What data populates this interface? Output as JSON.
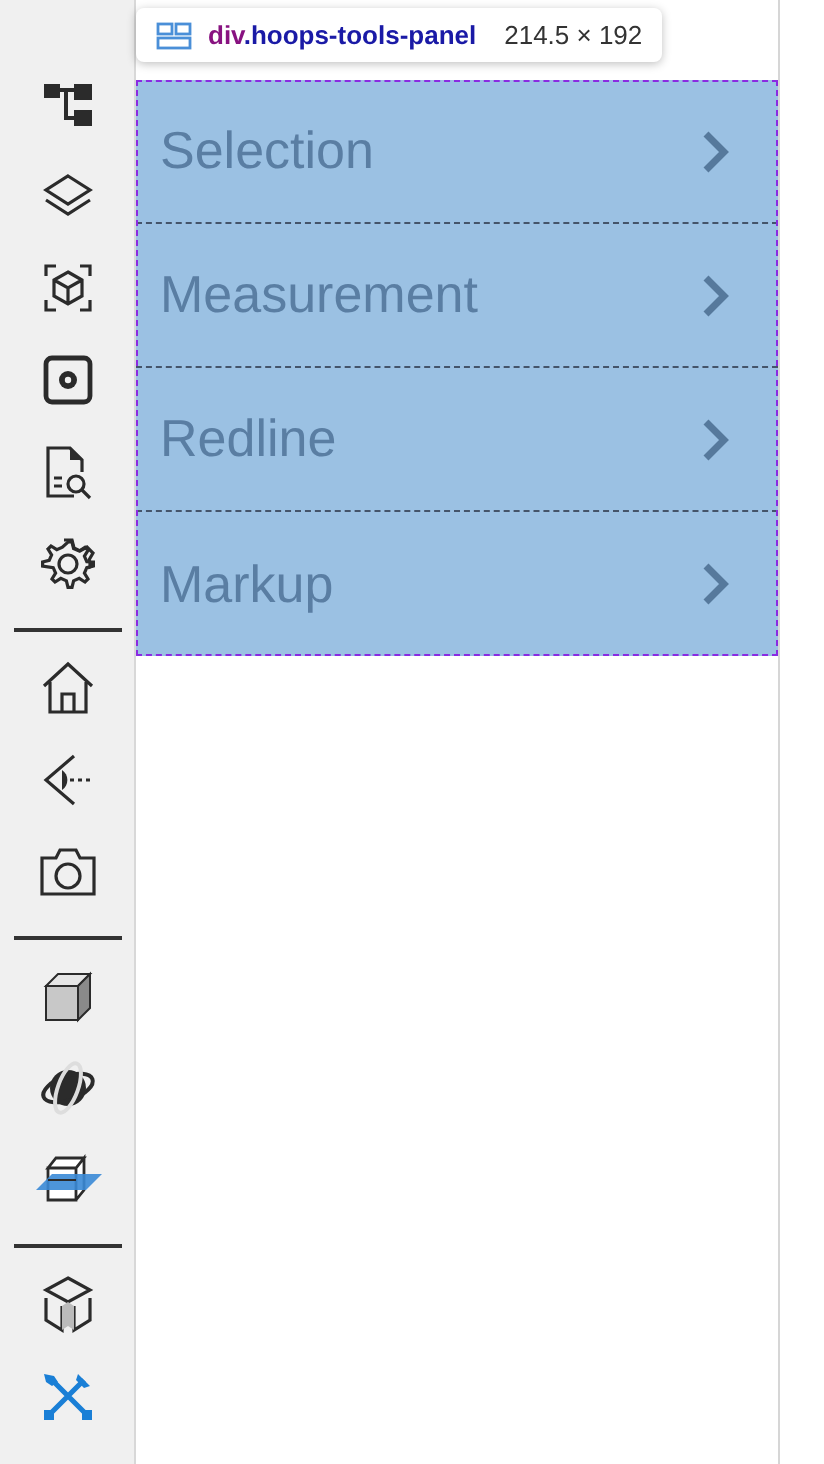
{
  "toolbar": {
    "groups": [
      {
        "items": [
          {
            "selected": false
          },
          {
            "selected": false
          },
          {
            "selected": false
          },
          {
            "selected": false
          },
          {
            "selected": false
          },
          {
            "selected": false
          }
        ]
      },
      {
        "items": [
          {
            "selected": false
          },
          {
            "selected": false
          },
          {
            "selected": false
          }
        ]
      },
      {
        "items": [
          {
            "selected": false
          },
          {
            "selected": false
          },
          {
            "selected": false
          }
        ]
      },
      {
        "items": [
          {
            "selected": false
          },
          {
            "selected": true
          }
        ]
      }
    ]
  },
  "inspector_tooltip": {
    "tag": "div",
    "class_name": ".hoops-tools-panel",
    "size": "214.5 × 192"
  },
  "tools_panel": {
    "items": [
      {
        "label": "Selection"
      },
      {
        "label": "Measurement"
      },
      {
        "label": "Redline"
      },
      {
        "label": "Markup"
      }
    ]
  }
}
